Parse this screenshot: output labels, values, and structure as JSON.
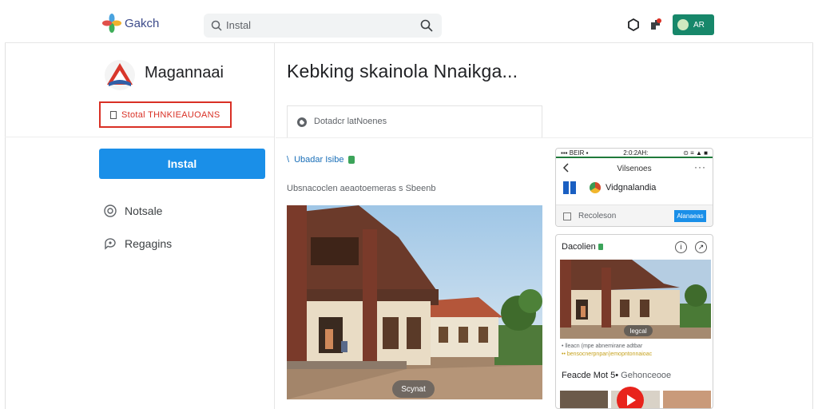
{
  "header": {
    "logo_text": "Gakch",
    "search_placeholder": "Instal",
    "account_label": "AR",
    "colors": {
      "account": "#17876a",
      "accent": "#1a8fe8"
    }
  },
  "app": {
    "name": "Magannaai",
    "badge": "Stotal THNKIEAUOANS",
    "install_label": "Instal",
    "links": [
      {
        "label": "Notsale",
        "icon": "target-icon"
      },
      {
        "label": "Regagins",
        "icon": "chat-icon"
      }
    ]
  },
  "main": {
    "title": "Kebking skainola Nnaikga...",
    "description": "Dotadcr latNoenes",
    "review_link": "Ubadar Isibe",
    "sub_text": "Ubsnacoclen aeaotoemeras s Sbeenb",
    "photo_label": "Scynat"
  },
  "phone": {
    "status_left": "▪▪▪ BEIR ▪",
    "status_center": "2:0:2AH:",
    "status_right": "⊙ ≡ ▲ ■",
    "title": "Vilsenoes",
    "app_name": "Vidgnalandia",
    "footer_label": "Recoleson",
    "button_label": "Alanaeas"
  },
  "gallery": {
    "title": "Dacolien",
    "pill": "Iegcal",
    "meta_line1": "• lleacn (mpe abnemirane adtbar",
    "meta_line2": "•• bensocnerpnpan)emopntonnaioac",
    "sub_bold": "Feacde Mot 5•",
    "sub_grey": "Gehonceooe"
  }
}
